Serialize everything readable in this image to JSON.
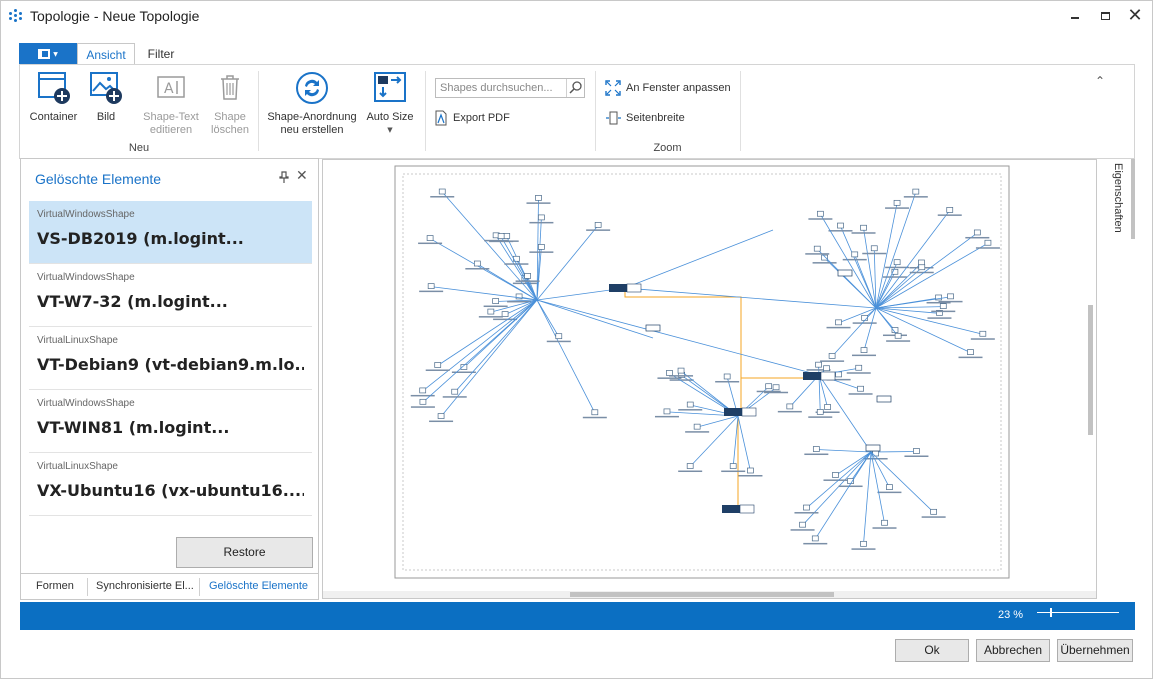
{
  "window": {
    "title": "Topologie - Neue Topologie"
  },
  "ribbon": {
    "tabs": [
      {
        "label": "Ansicht",
        "active": true
      },
      {
        "label": "Filter",
        "active": false
      }
    ],
    "groups": {
      "neu": {
        "label": "Neu",
        "buttons": [
          {
            "label": "Container",
            "enabled": true
          },
          {
            "label": "Bild",
            "enabled": true
          },
          {
            "label": "Shape-Text editieren",
            "enabled": false
          },
          {
            "label": "Shape löschen",
            "enabled": false
          }
        ]
      },
      "arrange": {
        "buttons": [
          {
            "label": "Shape-Anordnung neu erstellen",
            "enabled": true
          },
          {
            "label": "Auto Size",
            "enabled": true
          }
        ]
      },
      "search": {
        "placeholder": "Shapes durchsuchen...",
        "export_label": "Export PDF"
      },
      "zoom": {
        "label": "Zoom",
        "buttons": [
          {
            "label": "An Fenster anpassen"
          },
          {
            "label": "Seitenbreite"
          }
        ]
      }
    }
  },
  "left_panel": {
    "title": "Gelöschte Elemente",
    "items": [
      {
        "type": "VirtualWindowsShape",
        "name": "VS-DB2019 (m.logint...",
        "selected": true
      },
      {
        "type": "VirtualWindowsShape",
        "name": "VT-W7-32 (m.logint...",
        "selected": false
      },
      {
        "type": "VirtualLinuxShape",
        "name": "VT-Debian9 (vt-debian9.m.lo...",
        "selected": false
      },
      {
        "type": "VirtualWindowsShape",
        "name": "VT-WIN81 (m.logint...",
        "selected": false
      },
      {
        "type": "VirtualLinuxShape",
        "name": "VX-Ubuntu16 (vx-ubuntu16....",
        "selected": false
      }
    ],
    "restore_label": "Restore",
    "tabs": [
      {
        "label": "Formen",
        "active": false
      },
      {
        "label": "Synchronisierte El...",
        "active": false
      },
      {
        "label": "Gelöschte Elemente",
        "active": true
      }
    ]
  },
  "right_panel": {
    "label": "Eigenschaften"
  },
  "status": {
    "zoom_level": "23 %"
  },
  "footer": {
    "ok": "Ok",
    "cancel": "Abbrechen",
    "apply": "Übernehmen"
  },
  "colors": {
    "accent": "#1a73c8",
    "statusbar": "#0b6fc2",
    "selection": "#cce4f7",
    "edge": "#4a90d9",
    "edge_orange": "#f5a623",
    "node": "#1f3f66"
  }
}
